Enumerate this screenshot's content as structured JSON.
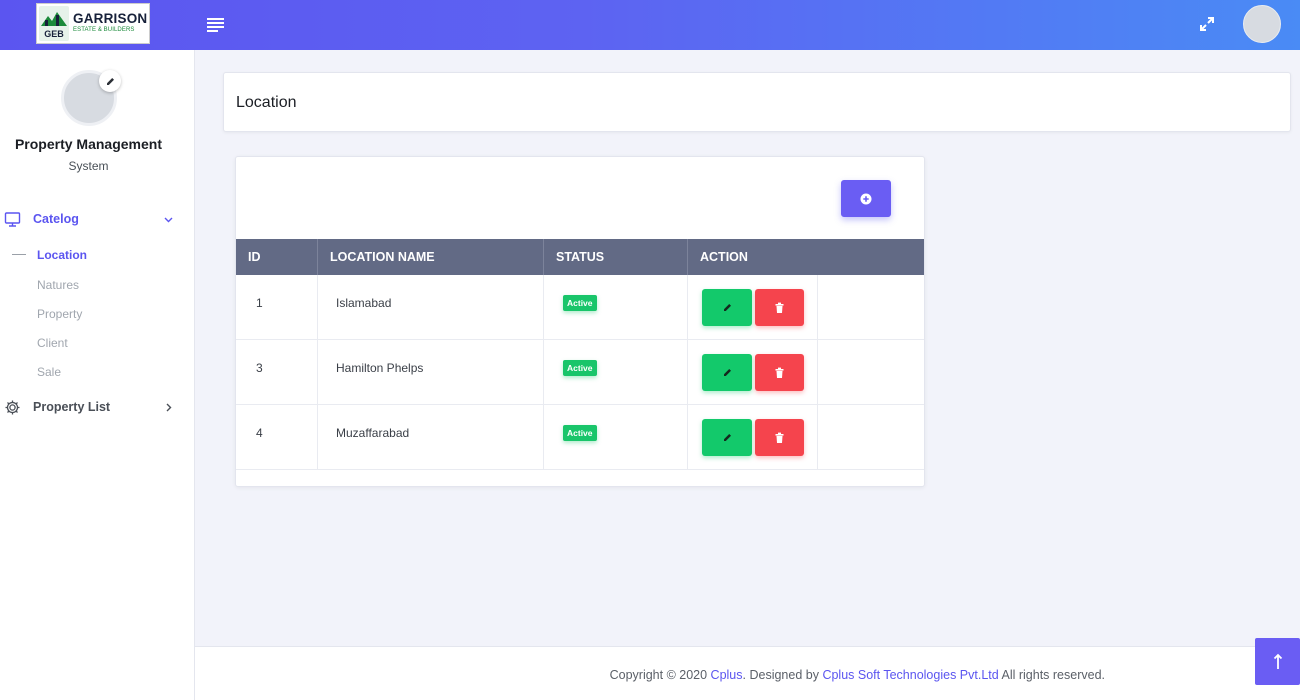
{
  "brand": {
    "title": "GARRISON",
    "subtitle": "ESTATE & BUILDERS",
    "mark_text": "GEB"
  },
  "profile": {
    "name": "Property Management",
    "subtitle": "System"
  },
  "sidebar": {
    "groups": [
      {
        "label": "Catelog",
        "icon": "monitor-icon",
        "expanded": true,
        "items": [
          {
            "label": "Location",
            "active": true
          },
          {
            "label": "Natures"
          },
          {
            "label": "Property"
          },
          {
            "label": "Client"
          },
          {
            "label": "Sale"
          }
        ]
      },
      {
        "label": "Property List",
        "icon": "gear-icon",
        "expanded": false,
        "items": []
      }
    ]
  },
  "page": {
    "title": "Location"
  },
  "table": {
    "columns": [
      "ID",
      "LOCATION NAME",
      "STATUS",
      "ACTION"
    ],
    "rows": [
      {
        "id": "1",
        "name": "Islamabad",
        "status": "Active"
      },
      {
        "id": "3",
        "name": "Hamilton Phelps",
        "status": "Active"
      },
      {
        "id": "4",
        "name": "Muzaffarabad",
        "status": "Active"
      }
    ]
  },
  "footer": {
    "prefix": "Copyright © 2020 ",
    "link1": "Cplus",
    "middle": ". Designed by ",
    "link2": "Cplus Soft Technologies Pvt.Ltd",
    "suffix": " All rights reserved."
  },
  "colors": {
    "accent": "#5b55f0",
    "header_gradient_end": "#4a8bf5",
    "table_header": "#626a85",
    "success": "#13c96b",
    "danger": "#f5444d"
  }
}
